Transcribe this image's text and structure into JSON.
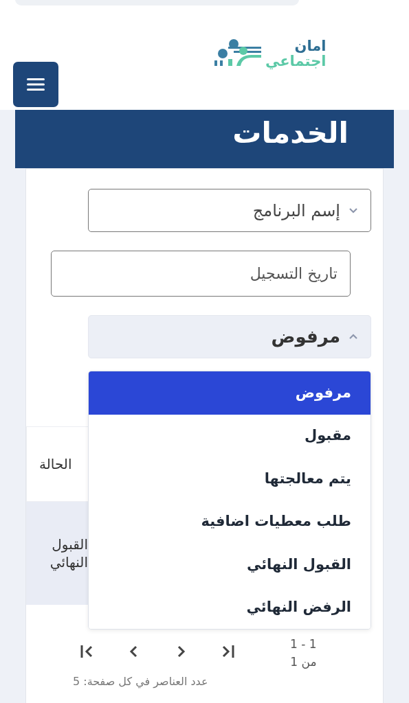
{
  "header": {
    "logo_lines": [
      "امان",
      "اجتماعي"
    ]
  },
  "page_title": "الخدمات",
  "filters": [
    {
      "kind": "select",
      "label": "إسم البرنامج",
      "expanded": false
    },
    {
      "kind": "date",
      "placeholder": "تاريخ التسجيل"
    },
    {
      "kind": "select",
      "label": "مرفوض",
      "expanded": true,
      "options": [
        {
          "label": "مرفوض",
          "selected": true
        },
        {
          "label": "مقبول",
          "selected": false
        },
        {
          "label": "يتم معالجتها",
          "selected": false
        },
        {
          "label": "طلب معطيات اضافية",
          "selected": false
        },
        {
          "label": "القبول النهائي",
          "selected": false
        },
        {
          "label": "الرفض النهائي",
          "selected": false
        }
      ]
    }
  ],
  "table": {
    "columns": [
      "الحالة"
    ],
    "rows": [
      [
        "القبول النهائي"
      ]
    ]
  },
  "pagination": {
    "range": "1 - 1",
    "total": "من 1",
    "page_size": "عدد العناصر في كل صفحة: 5"
  }
}
